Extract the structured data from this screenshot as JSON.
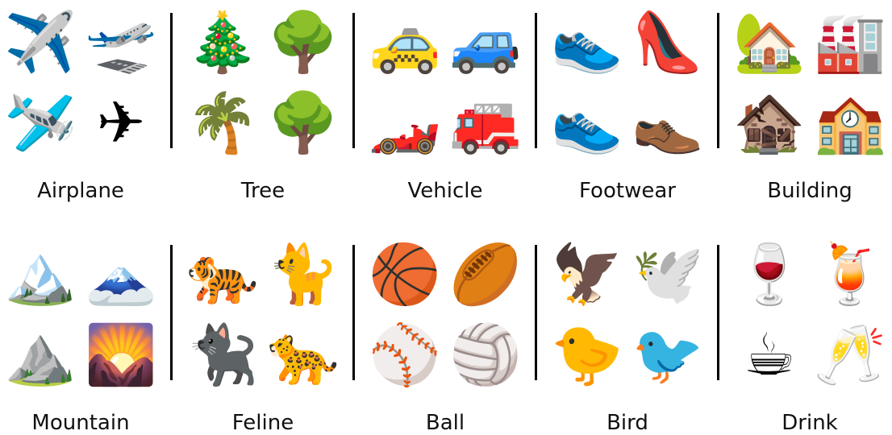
{
  "categories": [
    {
      "label": "Airplane",
      "icons": [
        {
          "name": "airplane-gray-icon",
          "glyph": "✈️"
        },
        {
          "name": "airplane-white-blue-icon",
          "glyph": "🛫"
        },
        {
          "name": "airplane-orange-icon",
          "glyph": "🛩️"
        },
        {
          "name": "airplane-yellow-icon",
          "glyph": "✈"
        }
      ]
    },
    {
      "label": "Tree",
      "icons": [
        {
          "name": "christmas-tree-icon",
          "glyph": "🎄"
        },
        {
          "name": "deciduous-tree-icon",
          "glyph": "🌳"
        },
        {
          "name": "palm-tree-icon",
          "glyph": "🌴"
        },
        {
          "name": "leafy-tree-icon",
          "glyph": "🌳"
        }
      ]
    },
    {
      "label": "Vehicle",
      "icons": [
        {
          "name": "taxi-icon",
          "glyph": "🚕"
        },
        {
          "name": "blue-car-icon",
          "glyph": "🚙"
        },
        {
          "name": "racing-car-icon",
          "glyph": "🏎️"
        },
        {
          "name": "fire-engine-icon",
          "glyph": "🚒"
        }
      ]
    },
    {
      "label": "Footwear",
      "icons": [
        {
          "name": "running-shoe-gray-icon",
          "glyph": "👟"
        },
        {
          "name": "high-heel-icon",
          "glyph": "👠"
        },
        {
          "name": "sneaker-red-icon",
          "glyph": "👟"
        },
        {
          "name": "brown-shoe-icon",
          "glyph": "👞"
        }
      ]
    },
    {
      "label": "Building",
      "icons": [
        {
          "name": "house-with-garden-icon",
          "glyph": "🏡"
        },
        {
          "name": "factory-icon",
          "glyph": "🏭"
        },
        {
          "name": "derelict-house-icon",
          "glyph": "🏚️"
        },
        {
          "name": "school-icon",
          "glyph": "🏫"
        }
      ]
    },
    {
      "label": "Mountain",
      "icons": [
        {
          "name": "snow-capped-mountain-icon",
          "glyph": "🏔️"
        },
        {
          "name": "mount-fuji-icon",
          "glyph": "🗻"
        },
        {
          "name": "mountain-icon",
          "glyph": "⛰️"
        },
        {
          "name": "sunrise-over-mountains-icon",
          "glyph": "🌄"
        }
      ]
    },
    {
      "label": "Feline",
      "icons": [
        {
          "name": "tiger-icon",
          "glyph": "🐅"
        },
        {
          "name": "white-cat-icon",
          "glyph": "🐈"
        },
        {
          "name": "black-cat-icon",
          "glyph": "🐈‍⬛"
        },
        {
          "name": "leopard-icon",
          "glyph": "🐆"
        }
      ]
    },
    {
      "label": "Ball",
      "icons": [
        {
          "name": "basketball-icon",
          "glyph": "🏀"
        },
        {
          "name": "rugby-ball-icon",
          "glyph": "🏉"
        },
        {
          "name": "baseball-icon",
          "glyph": "⚾"
        },
        {
          "name": "volleyball-icon",
          "glyph": "🏐"
        }
      ]
    },
    {
      "label": "Bird",
      "icons": [
        {
          "name": "eagle-icon",
          "glyph": "🦅"
        },
        {
          "name": "dove-icon",
          "glyph": "🕊️"
        },
        {
          "name": "baby-chick-icon",
          "glyph": "🐤"
        },
        {
          "name": "cardinal-bird-icon",
          "glyph": "🐦"
        }
      ]
    },
    {
      "label": "Drink",
      "icons": [
        {
          "name": "wine-glass-icon",
          "glyph": "🍷"
        },
        {
          "name": "tropical-drink-icon",
          "glyph": "🍹"
        },
        {
          "name": "hot-beverage-icon",
          "glyph": "☕"
        },
        {
          "name": "clinking-glasses-icon",
          "glyph": "🥂"
        }
      ]
    }
  ]
}
